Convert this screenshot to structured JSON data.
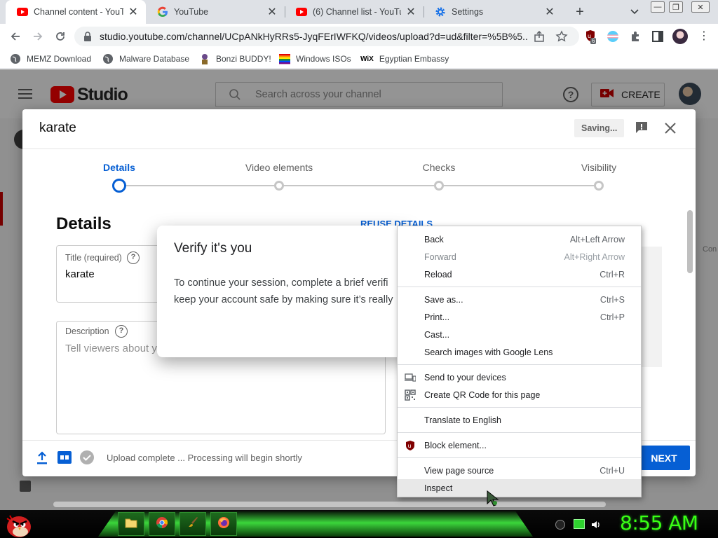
{
  "browser": {
    "tabs": [
      {
        "title": "Channel content - YouTube Studio",
        "active": true,
        "icon": "youtube-icon"
      },
      {
        "title": "YouTube",
        "active": false,
        "icon": "google-icon"
      },
      {
        "title": "(6) Channel list - YouTube",
        "active": false,
        "icon": "youtube-icon"
      },
      {
        "title": "Settings",
        "active": false,
        "icon": "gear-icon"
      }
    ],
    "new_tab": "+",
    "url": "studio.youtube.com/channel/UCpANkHyRRs5-JyqFErIWFKQ/videos/upload?d=ud&filter=%5B%5...",
    "extension_badge": "6",
    "bookmarks": [
      "MEMZ Download",
      "Malware Database",
      "Bonzi BUDDY!",
      "Windows ISOs",
      "Egyptian Embassy"
    ],
    "bookmark_wix_badge": "WiX"
  },
  "studio": {
    "logo_text": "Studio",
    "search_placeholder": "Search across your channel",
    "help_icon": "?",
    "create_label": "CREATE",
    "side_fragment": "Con"
  },
  "upload": {
    "title": "karate",
    "saving": "Saving...",
    "steps": [
      {
        "label": "Details",
        "active": true
      },
      {
        "label": "Video elements",
        "active": false
      },
      {
        "label": "Checks",
        "active": false
      },
      {
        "label": "Visibility",
        "active": false
      }
    ],
    "section_title": "Details",
    "reuse": "REUSE DETAILS",
    "title_field_label": "Title (required)",
    "title_field_value": "karate",
    "description_label": "Description",
    "description_placeholder": "Tell viewers about y",
    "status": "Upload complete ... Processing will begin shortly",
    "next": "NEXT"
  },
  "verify": {
    "title": "Verify it's you",
    "body_line1": "To continue your session, complete a brief verifi",
    "body_line2": "keep your account safe by making sure it’s really"
  },
  "context_menu": {
    "groups": [
      [
        {
          "label": "Back",
          "shortcut": "Alt+Left Arrow",
          "disabled": false,
          "icon": ""
        },
        {
          "label": "Forward",
          "shortcut": "Alt+Right Arrow",
          "disabled": true,
          "icon": ""
        },
        {
          "label": "Reload",
          "shortcut": "Ctrl+R",
          "disabled": false,
          "icon": ""
        }
      ],
      [
        {
          "label": "Save as...",
          "shortcut": "Ctrl+S",
          "disabled": false,
          "icon": ""
        },
        {
          "label": "Print...",
          "shortcut": "Ctrl+P",
          "disabled": false,
          "icon": ""
        },
        {
          "label": "Cast...",
          "shortcut": "",
          "disabled": false,
          "icon": ""
        },
        {
          "label": "Search images with Google Lens",
          "shortcut": "",
          "disabled": false,
          "icon": ""
        }
      ],
      [
        {
          "label": "Send to your devices",
          "shortcut": "",
          "disabled": false,
          "icon": "devices-icon"
        },
        {
          "label": "Create QR Code for this page",
          "shortcut": "",
          "disabled": false,
          "icon": "qr-code-icon"
        }
      ],
      [
        {
          "label": "Translate to English",
          "shortcut": "",
          "disabled": false,
          "icon": ""
        }
      ],
      [
        {
          "label": "Block element...",
          "shortcut": "",
          "disabled": false,
          "icon": "ublock-icon"
        }
      ],
      [
        {
          "label": "View page source",
          "shortcut": "Ctrl+U",
          "disabled": false,
          "icon": ""
        },
        {
          "label": "Inspect",
          "shortcut": "",
          "disabled": false,
          "icon": "",
          "highlighted": true
        }
      ]
    ]
  },
  "taskbar": {
    "clock": "8:55 AM",
    "apps": [
      "explorer-icon",
      "chrome-icon",
      "paint-icon",
      "firefox-icon"
    ]
  },
  "colors": {
    "youtube_red": "#ff0000",
    "studio_blue": "#065fd4",
    "clock_green": "#39ff14"
  }
}
